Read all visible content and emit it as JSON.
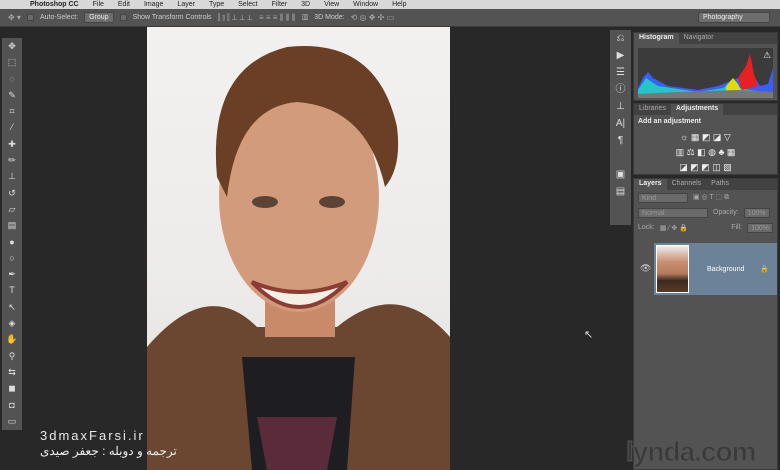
{
  "menu": [
    "Photoshop CC",
    "File",
    "Edit",
    "Image",
    "Layer",
    "Type",
    "Select",
    "Filter",
    "3D",
    "View",
    "Window",
    "Help"
  ],
  "options": {
    "auto_select_label": "Auto-Select:",
    "auto_select_value": "Group",
    "transform_label": "Show Transform Controls",
    "mode_3d_label": "3D Mode:",
    "workspace": "Photography"
  },
  "panels": {
    "histogram": {
      "tabs": [
        "Histogram",
        "Navigator"
      ]
    },
    "adjustments": {
      "tabs": [
        "Libraries",
        "Adjustments"
      ],
      "heading": "Add an adjustment"
    },
    "layers": {
      "tabs": [
        "Layers",
        "Channels",
        "Paths"
      ],
      "filter": "Kind",
      "blend_mode": "Normal",
      "opacity_label": "Opacity:",
      "opacity": "100%",
      "lock_label": "Lock:",
      "fill_label": "Fill:",
      "fill": "100%",
      "layer_name": "Background"
    }
  },
  "watermark": {
    "site": "3dmaxFarsi.ir",
    "credit": "ترجمه و دوبله : جعفر صیدی",
    "lynda": "lynda.com"
  }
}
